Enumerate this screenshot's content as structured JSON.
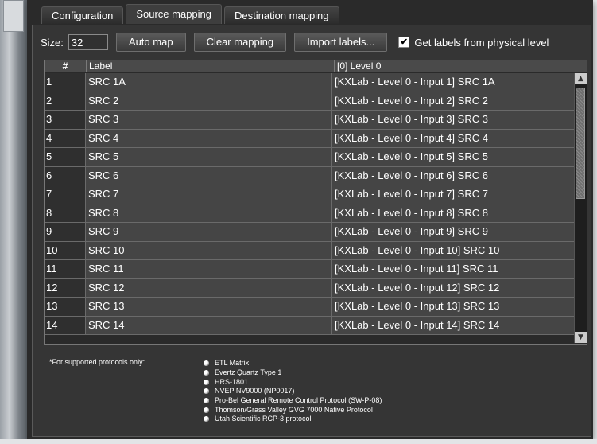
{
  "tabs": [
    {
      "label": "Configuration",
      "active": false
    },
    {
      "label": "Source mapping",
      "active": true
    },
    {
      "label": "Destination mapping",
      "active": false
    }
  ],
  "toolbar": {
    "size_label": "Size:",
    "size_value": "32",
    "auto_map": "Auto map",
    "clear_mapping": "Clear mapping",
    "import_labels": "Import labels...",
    "get_labels_checkbox": "Get labels from physical level",
    "get_labels_checked": true
  },
  "grid": {
    "headers": {
      "num": "#",
      "label": "Label",
      "level": "[0] Level 0"
    },
    "rows": [
      {
        "num": "1",
        "label": "SRC 1A",
        "level": "[KXLab - Level 0 - Input 1] SRC 1A"
      },
      {
        "num": "2",
        "label": "SRC  2",
        "level": "[KXLab - Level 0 - Input 2] SRC  2"
      },
      {
        "num": "3",
        "label": "SRC  3",
        "level": "[KXLab - Level 0 - Input 3] SRC  3"
      },
      {
        "num": "4",
        "label": "SRC  4",
        "level": "[KXLab - Level 0 - Input 4] SRC  4"
      },
      {
        "num": "5",
        "label": "SRC  5",
        "level": "[KXLab - Level 0 - Input 5] SRC  5"
      },
      {
        "num": "6",
        "label": "SRC  6",
        "level": "[KXLab - Level 0 - Input 6] SRC  6"
      },
      {
        "num": "7",
        "label": "SRC  7",
        "level": "[KXLab - Level 0 - Input 7] SRC  7"
      },
      {
        "num": "8",
        "label": "SRC  8",
        "level": "[KXLab - Level 0 - Input 8] SRC  8"
      },
      {
        "num": "9",
        "label": "SRC  9",
        "level": "[KXLab - Level 0 - Input 9] SRC  9"
      },
      {
        "num": "10",
        "label": "SRC 10",
        "level": "[KXLab - Level 0 - Input 10] SRC 10"
      },
      {
        "num": "11",
        "label": "SRC 11",
        "level": "[KXLab - Level 0 - Input 11] SRC 11"
      },
      {
        "num": "12",
        "label": "SRC 12",
        "level": "[KXLab - Level 0 - Input 12] SRC 12"
      },
      {
        "num": "13",
        "label": "SRC 13",
        "level": "[KXLab - Level 0 - Input 13] SRC 13"
      },
      {
        "num": "14",
        "label": "SRC 14",
        "level": "[KXLab - Level 0 - Input 14] SRC 14"
      }
    ]
  },
  "footnote": "*For supported protocols only:",
  "protocols": [
    "ETL Matrix",
    "Evertz Quartz Type 1",
    "HRS-1801",
    "NVEP NV9000 (NP0017)",
    "Pro-Bel General Remote Control Protocol (SW-P-08)",
    "Thomson/Grass Valley GVG 7000 Native Protocol",
    "Utah Scientific RCP-3 protocol"
  ],
  "icons": {
    "checkbox_mark": "check-icon",
    "bullet": "bullet-icon",
    "scroll_up": "arrow-up-icon",
    "scroll_down": "arrow-down-icon"
  }
}
